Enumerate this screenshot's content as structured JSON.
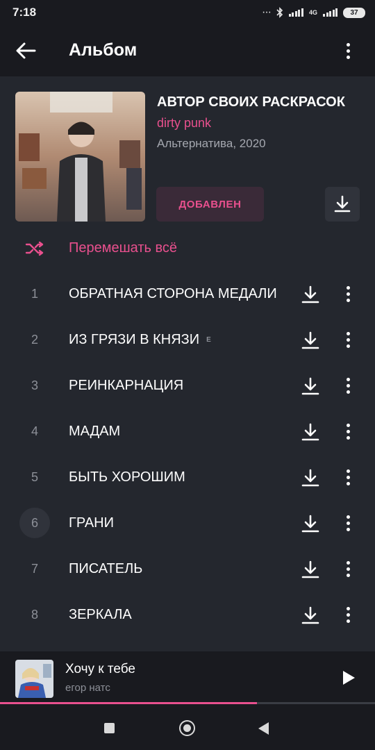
{
  "status_bar": {
    "time": "7:18",
    "dots": "···",
    "network": "4G",
    "battery": "37"
  },
  "app_bar": {
    "title": "Альбом"
  },
  "album": {
    "title": "АВТОР СВОИХ РАСКРАСОК",
    "artist": "dirty punk",
    "meta": "Альтернатива, 2020",
    "added_label": "ДОБАВЛЕН"
  },
  "shuffle": {
    "label": "Перемешать всё"
  },
  "tracks": [
    {
      "num": "1",
      "title": "ОБРАТНАЯ СТОРОНА МЕДАЛИ",
      "explicit": ""
    },
    {
      "num": "2",
      "title": "ИЗ ГРЯЗИ В КНЯЗИ",
      "explicit": "E"
    },
    {
      "num": "3",
      "title": "РЕИНКАРНАЦИЯ",
      "explicit": ""
    },
    {
      "num": "4",
      "title": "МАДАМ",
      "explicit": ""
    },
    {
      "num": "5",
      "title": "БЫТЬ ХОРОШИМ",
      "explicit": ""
    },
    {
      "num": "6",
      "title": "ГРАНИ",
      "explicit": ""
    },
    {
      "num": "7",
      "title": "ПИСАТЕЛЬ",
      "explicit": ""
    },
    {
      "num": "8",
      "title": "ЗЕРКАЛА",
      "explicit": ""
    }
  ],
  "now_playing": {
    "title": "Хочу к тебе",
    "artist": "егор натс",
    "progress_fraction": 0.685
  },
  "colors": {
    "accent": "#e9508e",
    "background": "#24272e",
    "bar": "#191a1f"
  }
}
